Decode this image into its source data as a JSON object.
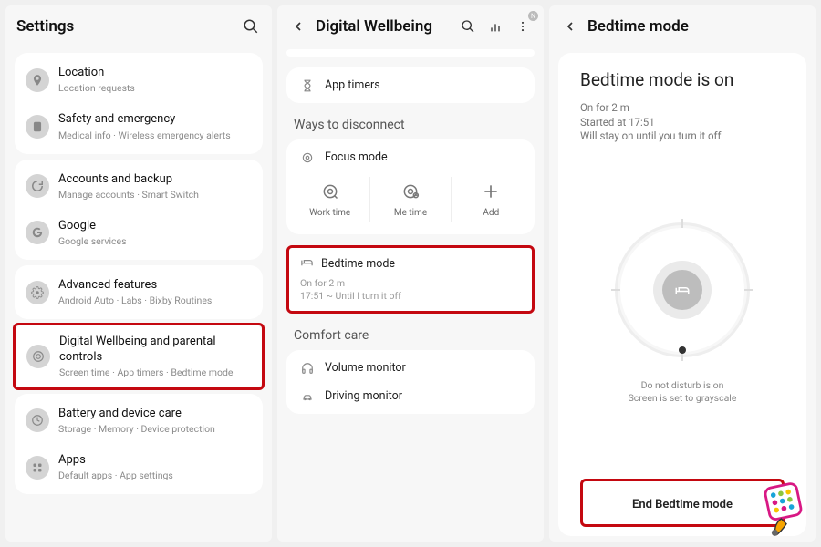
{
  "panel1": {
    "title": "Settings",
    "groups": [
      [
        {
          "title": "Location",
          "sub": "Location requests",
          "icon": "location"
        },
        {
          "title": "Safety and emergency",
          "sub": "Medical info · Wireless emergency alerts",
          "icon": "safety"
        }
      ],
      [
        {
          "title": "Accounts and backup",
          "sub": "Manage accounts · Smart Switch",
          "icon": "accounts"
        },
        {
          "title": "Google",
          "sub": "Google services",
          "icon": "google"
        }
      ],
      [
        {
          "title": "Advanced features",
          "sub": "Android Auto · Labs · Bixby Routines",
          "icon": "advanced"
        }
      ],
      [
        {
          "title": "Digital Wellbeing and parental controls",
          "sub": "Screen time · App timers · Bedtime mode",
          "icon": "wellbeing",
          "highlight": true
        }
      ],
      [
        {
          "title": "Battery and device care",
          "sub": "Storage · Memory · Device protection",
          "icon": "battery"
        },
        {
          "title": "Apps",
          "sub": "Default apps · App settings",
          "icon": "apps"
        }
      ]
    ]
  },
  "panel2": {
    "title": "Digital Wellbeing",
    "app_timers": "App timers",
    "disconnect_label": "Ways to disconnect",
    "focus_mode": "Focus mode",
    "focus_items": [
      {
        "label": "Work time",
        "icon": "worktime"
      },
      {
        "label": "Me time",
        "icon": "metime"
      },
      {
        "label": "Add",
        "icon": "add"
      }
    ],
    "bedtime": {
      "title": "Bedtime mode",
      "sub1": "On for 2 m",
      "sub2": "17:51 ~ Until I turn it off",
      "highlight": true
    },
    "comfort_label": "Comfort care",
    "comfort_items": [
      {
        "label": "Volume monitor",
        "icon": "headphones"
      },
      {
        "label": "Driving monitor",
        "icon": "car"
      }
    ]
  },
  "panel3": {
    "title": "Bedtime mode",
    "heading": "Bedtime mode is on",
    "lines": [
      "On for 2 m",
      "Started at 17:51",
      "Will stay on until you turn it off"
    ],
    "dial_sub": [
      "Do not disturb is on",
      "Screen is set to grayscale"
    ],
    "end_btn": "End Bedtime mode"
  }
}
